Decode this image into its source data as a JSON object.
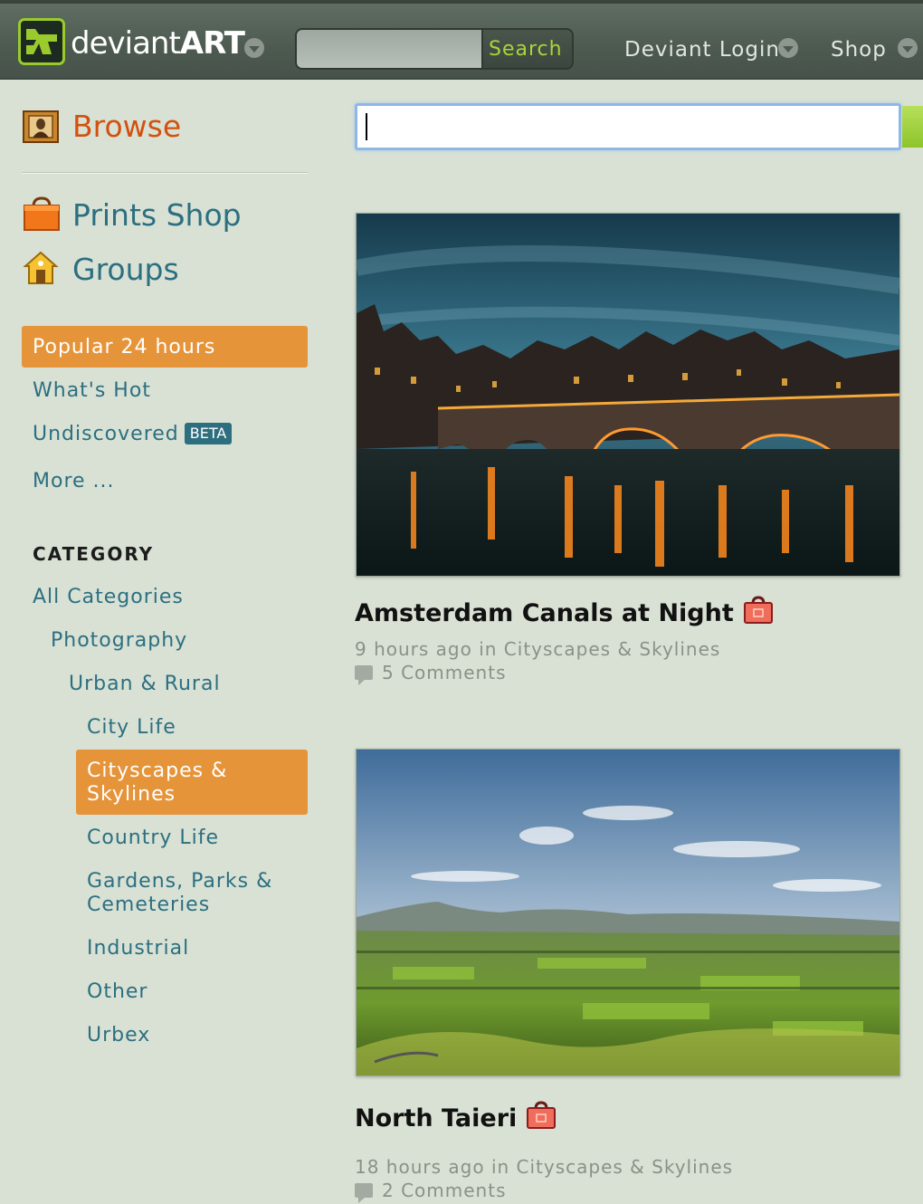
{
  "header": {
    "logo_text_light": "deviant",
    "logo_text_bold": "ART",
    "search_placeholder": "",
    "search_button": "Search",
    "login_label": "Deviant Login",
    "shop_label": "Shop"
  },
  "sidebar": {
    "browse": "Browse",
    "prints_shop": "Prints Shop",
    "groups": "Groups",
    "sort": [
      {
        "label": "Popular 24 hours",
        "active": true
      },
      {
        "label": "What's Hot",
        "active": false
      },
      {
        "label": "Undiscovered",
        "active": false,
        "badge": "BETA"
      },
      {
        "label": "More ...",
        "active": false
      }
    ],
    "category_heading": "CATEGORY",
    "categories": [
      {
        "label": "All Categories",
        "level": 0
      },
      {
        "label": "Photography",
        "level": 1
      },
      {
        "label": "Urban & Rural",
        "level": 2
      },
      {
        "label": "City Life",
        "level": 3
      },
      {
        "label": "Cityscapes & Skylines",
        "level": 3,
        "active": true
      },
      {
        "label": "Country Life",
        "level": 3
      },
      {
        "label": "Gardens, Parks & Cemeteries",
        "level": 3
      },
      {
        "label": "Industrial",
        "level": 3
      },
      {
        "label": "Other",
        "level": 3
      },
      {
        "label": "Urbex",
        "level": 3
      }
    ]
  },
  "main": {
    "search_value": "",
    "deviations": [
      {
        "title": "Amsterdam Canals at Night",
        "meta": "9 hours ago in Cityscapes & Skylines",
        "comments": "5 Comments",
        "image": "night-canal-bridge"
      },
      {
        "title": "North Taieri",
        "meta": "18 hours ago in Cityscapes & Skylines",
        "comments": "2 Comments",
        "image": "green-valley-landscape"
      }
    ]
  },
  "colors": {
    "page_bg": "#d8e1d4",
    "topbar_bg": "#4d5a50",
    "link": "#2c6f80",
    "browse": "#d3510f",
    "active_bg": "#e6943a",
    "search_accent": "#a9d43a"
  }
}
